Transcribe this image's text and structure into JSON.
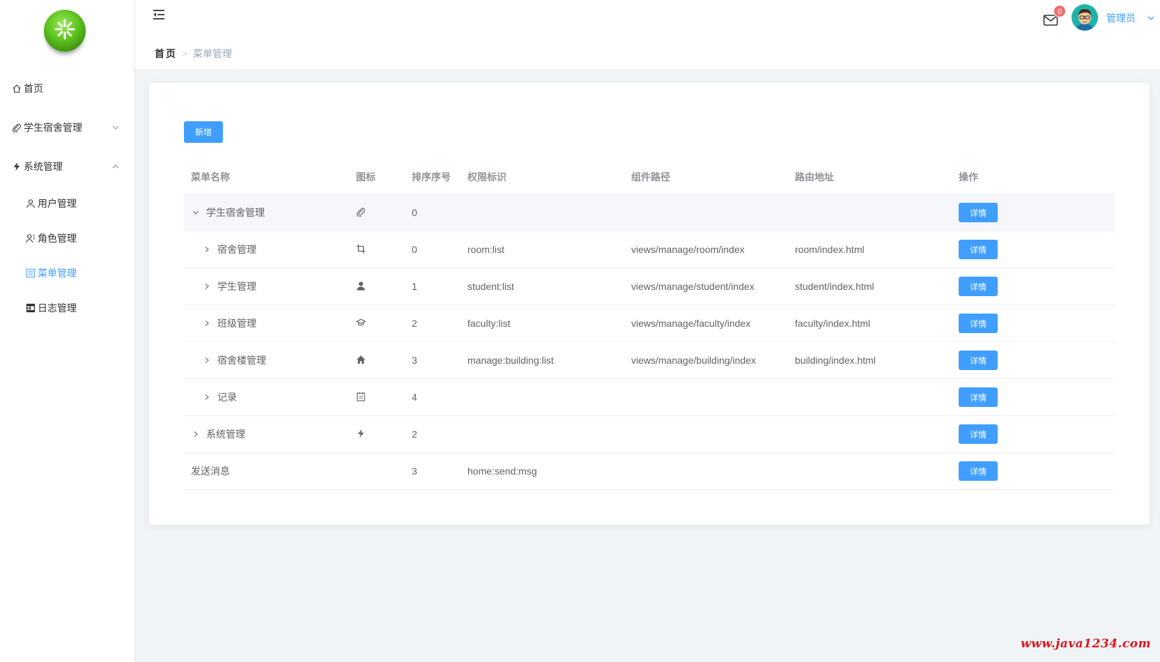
{
  "sidebar": {
    "items": [
      {
        "label": "首页",
        "icon": "home-icon"
      },
      {
        "label": "学生宿舍管理",
        "icon": "paperclip-icon",
        "expand": "chevron-down-icon"
      },
      {
        "label": "系统管理",
        "icon": "lightning-icon",
        "expand": "chevron-up-icon"
      },
      {
        "label": "用户管理",
        "icon": "user-icon"
      },
      {
        "label": "角色管理",
        "icon": "user-settings-icon"
      },
      {
        "label": "菜单管理",
        "icon": "list-icon",
        "active": true
      },
      {
        "label": "日志管理",
        "icon": "table-icon"
      }
    ],
    "active_color": "#409eff"
  },
  "header": {
    "breadcrumb": {
      "home": "首页",
      "current": "菜单管理"
    },
    "mail_badge": "0",
    "user_name": "管理员"
  },
  "toolbar": {
    "add_label": "新增"
  },
  "table": {
    "columns": [
      "菜单名称",
      "图标",
      "排序序号",
      "权限标识",
      "组件路径",
      "路由地址",
      "操作"
    ],
    "detail_label": "详情",
    "rows": [
      {
        "name": "学生宿舍管理",
        "icon": "paperclip-icon",
        "order": "0",
        "perm": "",
        "component": "",
        "route": "",
        "level": 0,
        "expander": "expanded"
      },
      {
        "name": "宿舍管理",
        "icon": "crop-icon",
        "order": "0",
        "perm": "room:list",
        "component": "views/manage/room/index",
        "route": "room/index.html",
        "level": 1,
        "expander": "collapsed"
      },
      {
        "name": "学生管理",
        "icon": "user-solid-icon",
        "order": "1",
        "perm": "student:list",
        "component": "views/manage/student/index",
        "route": "student/index.html",
        "level": 1,
        "expander": "collapsed"
      },
      {
        "name": "班级管理",
        "icon": "graduation-cap-icon",
        "order": "2",
        "perm": "faculty:list",
        "component": "views/manage/faculty/index",
        "route": "faculty/index.html",
        "level": 1,
        "expander": "collapsed"
      },
      {
        "name": "宿舍楼管理",
        "icon": "house-icon",
        "order": "3",
        "perm": "manage:building:list",
        "component": "views/manage/building/index",
        "route": "building/index.html",
        "level": 1,
        "expander": "collapsed"
      },
      {
        "name": "记录",
        "icon": "notebook-icon",
        "order": "4",
        "perm": "",
        "component": "",
        "route": "",
        "level": 1,
        "expander": "collapsed"
      },
      {
        "name": "系统管理",
        "icon": "lightning-icon",
        "order": "2",
        "perm": "",
        "component": "",
        "route": "",
        "level": 0,
        "expander": "collapsed"
      },
      {
        "name": "发送消息",
        "icon": "",
        "order": "3",
        "perm": "home:send:msg",
        "component": "",
        "route": "",
        "level": 0,
        "expander": "none"
      }
    ]
  },
  "watermark": "www.java1234.com"
}
